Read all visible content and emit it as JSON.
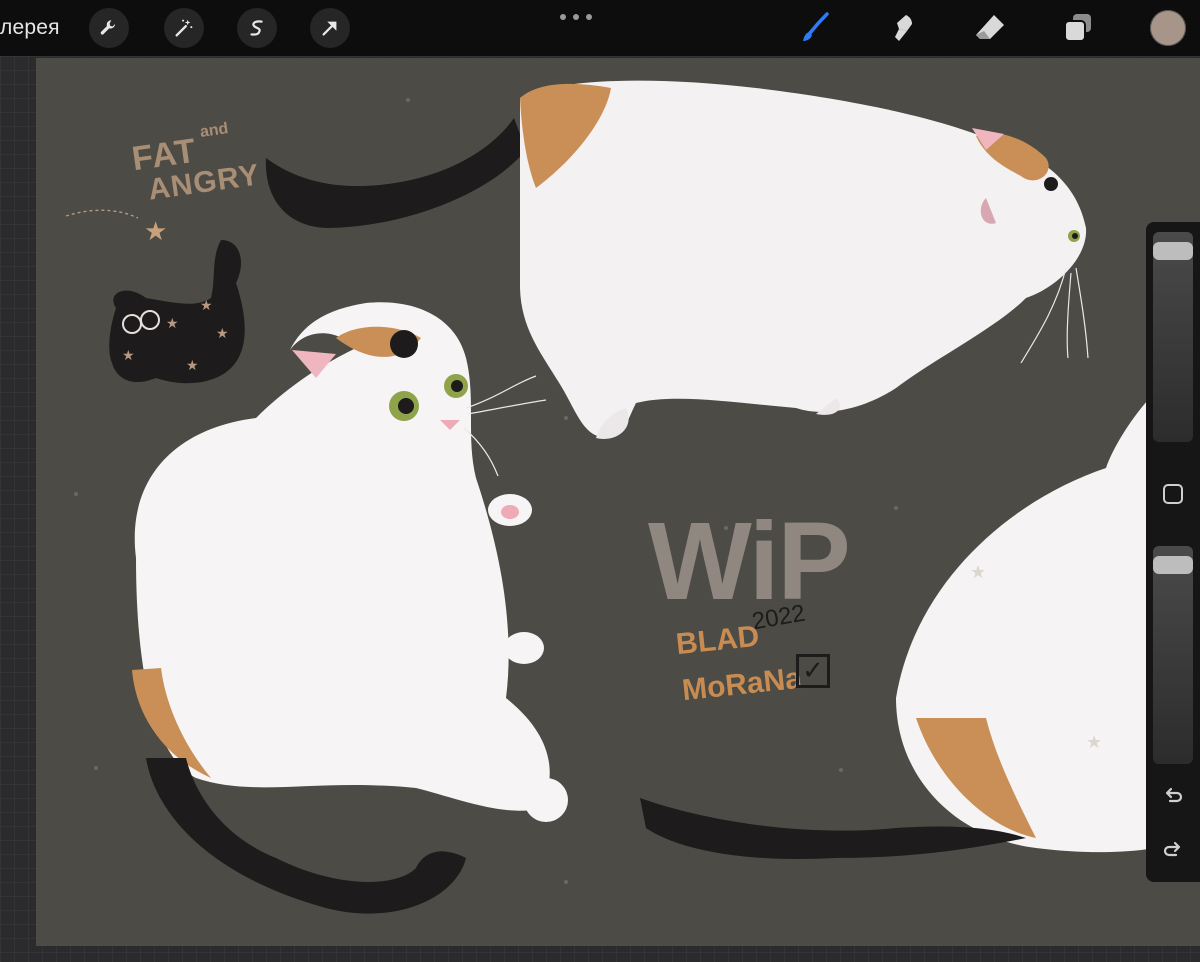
{
  "toolbar": {
    "gallery_label": "лерея",
    "tools_left": [
      {
        "name": "wrench-icon",
        "label": "Actions"
      },
      {
        "name": "magic-wand-icon",
        "label": "Adjustments"
      },
      {
        "name": "selection-icon",
        "label": "Selection"
      },
      {
        "name": "arrow-cursor-icon",
        "label": "Transform"
      }
    ],
    "more_icon": "ellipsis-icon",
    "tools_right": [
      {
        "name": "brush-icon",
        "active": true
      },
      {
        "name": "smudge-icon",
        "active": false
      },
      {
        "name": "eraser-icon",
        "active": false
      },
      {
        "name": "layers-icon",
        "active": false
      }
    ],
    "current_color": "#a8958a",
    "active_color": "#2f7bf5"
  },
  "canvas": {
    "background_color": "#4c4b45",
    "text_fat": "FAT",
    "text_and": "and",
    "text_angry": "ANGRY",
    "text_wip": "WiP",
    "text_year": "2022",
    "text_blad": "BLAD",
    "text_morana": "MoRaNa"
  },
  "sidebar": {
    "brush_size_level": 0.95,
    "opacity_level": 0.95,
    "modify_button": "square-icon",
    "undo_icon": "undo-icon",
    "redo_icon": "redo-icon"
  }
}
